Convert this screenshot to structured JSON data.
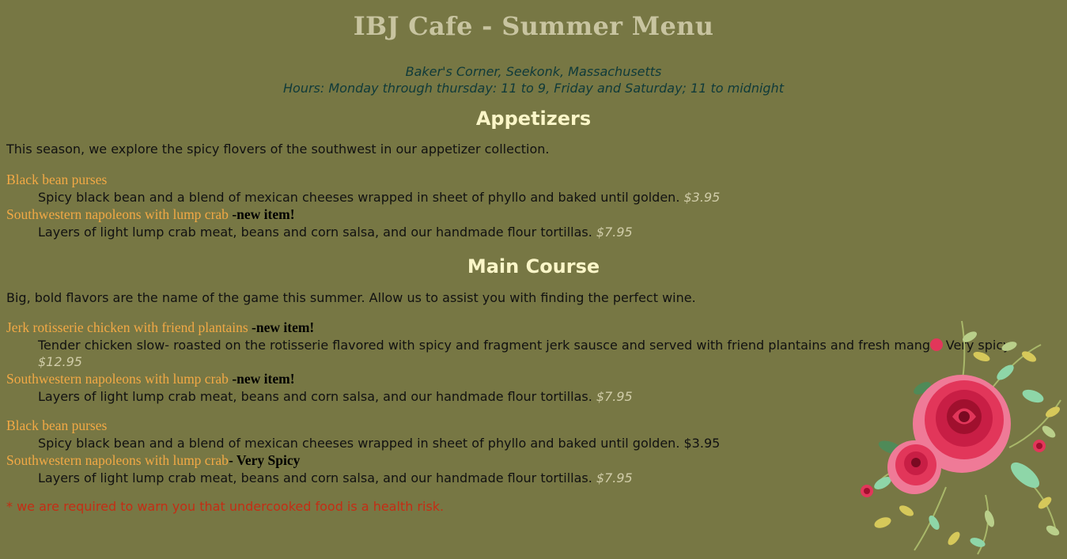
{
  "header": {
    "title": "IBJ Cafe - Summer Menu",
    "location": "Baker's Corner, Seekonk, Massachusetts",
    "hours": "Hours: Monday through thursday: 11 to 9, Friday and Saturday; 11 to midnight"
  },
  "appetizers": {
    "heading": "Appetizers",
    "intro": "This season, we explore the spicy flovers of the southwest in our appetizer collection.",
    "items": [
      {
        "name": "Black bean purses",
        "tag": "",
        "desc": "Spicy black bean and a blend of mexican cheeses wrapped in sheet of phyllo and baked until golden. ",
        "price": "$3.95"
      },
      {
        "name": "Southwestern napoleons with lump crab",
        "tag": " -new item!",
        "desc": "Layers of light lump crab meat, beans and corn salsa, and our handmade flour tortillas. ",
        "price": "$7.95"
      }
    ]
  },
  "main": {
    "heading": "Main Course",
    "intro": "Big, bold flavors are the name of the game this summer. Allow us to assist you with finding the perfect wine.",
    "items": [
      {
        "name": "Jerk rotisserie chicken with friend plantains",
        "tag": " -new item!",
        "desc": "Tender chicken slow- roasted on the rotisserie flavored with spicy and fragment jerk sausce and served with friend plantains and fresh mango. Very spicy. ",
        "price": "$12.95"
      },
      {
        "name": "Southwestern napoleons with lump crab",
        "tag": " -new item!",
        "desc": "Layers of light lump crab meat, beans and corn salsa, and our handmade flour tortillas. ",
        "price": "$7.95"
      }
    ],
    "items2": [
      {
        "name": "Black bean purses",
        "tag": "",
        "desc": "Spicy black bean and a blend of mexican cheeses wrapped in sheet of phyllo and baked until golden. ",
        "price": "$3.95"
      },
      {
        "name": "Southwestern napoleons with lump crab",
        "tag": "- Very Spicy",
        "desc": "Layers of light lump crab meat, beans and corn salsa, and our handmade flour tortillas. ",
        "price": "$7.95"
      }
    ]
  },
  "warning": "* we are required to warn you that undercooked food is a health risk.",
  "colors": {
    "background": "#777744",
    "item_name": "#f2a945",
    "heading": "#fbf6c8",
    "warning": "#c42d14"
  },
  "decoration": "rose-bouquet-illustration"
}
